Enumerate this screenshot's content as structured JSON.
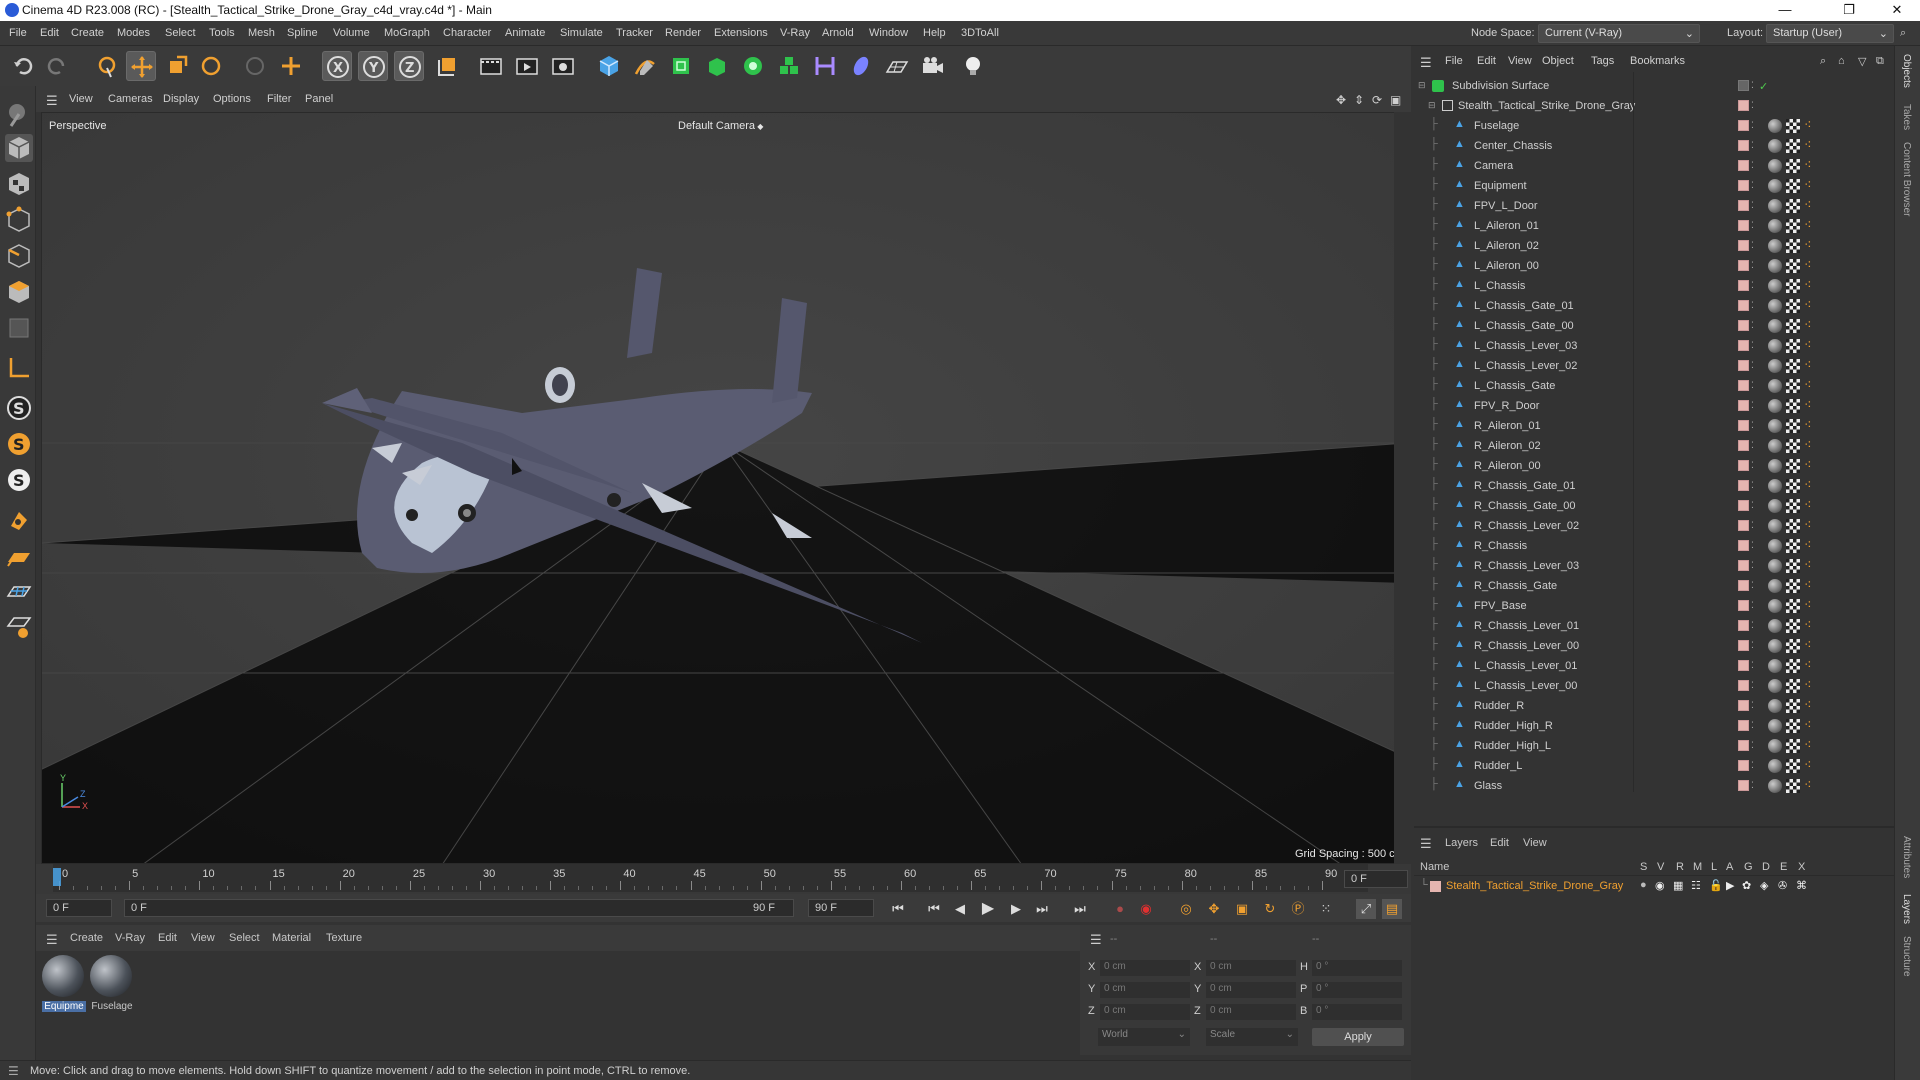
{
  "title_bar": {
    "title": "Cinema 4D R23.008 (RC) - [Stealth_Tactical_Strike_Drone_Gray_c4d_vray.c4d *] - Main",
    "minimize": "—",
    "maximize": "❐",
    "close": "✕"
  },
  "menu": [
    "File",
    "Edit",
    "Create",
    "Modes",
    "Select",
    "Tools",
    "Mesh",
    "Spline",
    "Volume",
    "MoGraph",
    "Character",
    "Animate",
    "Simulate",
    "Tracker",
    "Render",
    "Extensions",
    "V-Ray",
    "Arnold",
    "Window",
    "Help",
    "3DToAll"
  ],
  "node_space": {
    "label": "Node Space:",
    "value": "Current (V-Ray)"
  },
  "layout": {
    "label": "Layout:",
    "value": "Startup (User)"
  },
  "viewport": {
    "menu": [
      "View",
      "Cameras",
      "Display",
      "Options",
      "Filter",
      "Panel"
    ],
    "view_name": "Perspective",
    "camera": "Default Camera",
    "grid_spacing": "Grid Spacing : 500 cm",
    "axis": {
      "x": "X",
      "y": "Y",
      "z": "Z"
    }
  },
  "timeline": {
    "ticks": [
      "0",
      "5",
      "10",
      "15",
      "20",
      "25",
      "30",
      "35",
      "40",
      "45",
      "50",
      "55",
      "60",
      "65",
      "70",
      "75",
      "80",
      "85",
      "90"
    ],
    "end_field": "0 F",
    "current_frame": "0 F",
    "range_start": "0 F",
    "range_end": "90 F",
    "max_frame": "90 F"
  },
  "material_manager": {
    "menu": [
      "Create",
      "V-Ray",
      "Edit",
      "View",
      "Select",
      "Material",
      "Texture"
    ],
    "materials": [
      {
        "name": "Equipme"
      },
      {
        "name": "Fuselage"
      }
    ]
  },
  "coordinates": {
    "header": [
      "--",
      "--",
      "--"
    ],
    "rows": [
      {
        "a": "X",
        "av": "0 cm",
        "b": "X",
        "bv": "0 cm",
        "c": "H",
        "cv": "0 °"
      },
      {
        "a": "Y",
        "av": "0 cm",
        "b": "Y",
        "bv": "0 cm",
        "c": "P",
        "cv": "0 °"
      },
      {
        "a": "Z",
        "av": "0 cm",
        "b": "Z",
        "bv": "0 cm",
        "c": "B",
        "cv": "0 °"
      }
    ],
    "mode1": "World",
    "mode2": "Scale",
    "apply": "Apply"
  },
  "status": "Move: Click and drag to move elements. Hold down SHIFT to quantize movement / add to the selection in point mode, CTRL to remove.",
  "object_manager": {
    "menu": [
      "File",
      "Edit",
      "View",
      "Object",
      "Tags",
      "Bookmarks"
    ],
    "root": "Subdivision Surface",
    "group": "Stealth_Tactical_Strike_Drone_Gray",
    "objects": [
      "Fuselage",
      "Center_Chassis",
      "Camera",
      "Equipment",
      "FPV_L_Door",
      "L_Aileron_01",
      "L_Aileron_02",
      "L_Aileron_00",
      "L_Chassis",
      "L_Chassis_Gate_01",
      "L_Chassis_Gate_00",
      "L_Chassis_Lever_03",
      "L_Chassis_Lever_02",
      "L_Chassis_Gate",
      "FPV_R_Door",
      "R_Aileron_01",
      "R_Aileron_02",
      "R_Aileron_00",
      "R_Chassis_Gate_01",
      "R_Chassis_Gate_00",
      "R_Chassis_Lever_02",
      "R_Chassis",
      "R_Chassis_Lever_03",
      "R_Chassis_Gate",
      "FPV_Base",
      "R_Chassis_Lever_01",
      "R_Chassis_Lever_00",
      "L_Chassis_Lever_01",
      "L_Chassis_Lever_00",
      "Rudder_R",
      "Rudder_High_R",
      "Rudder_High_L",
      "Rudder_L",
      "Glass"
    ]
  },
  "layers": {
    "menu": [
      "Layers",
      "Edit",
      "View"
    ],
    "columns": [
      "Name",
      "S",
      "V",
      "R",
      "M",
      "L",
      "A",
      "G",
      "D",
      "E",
      "X"
    ],
    "layer_name": "Stealth_Tactical_Strike_Drone_Gray"
  },
  "side_tabs": [
    "Objects",
    "Takes",
    "Content Browser",
    "Attributes",
    "Layers",
    "Structure"
  ]
}
